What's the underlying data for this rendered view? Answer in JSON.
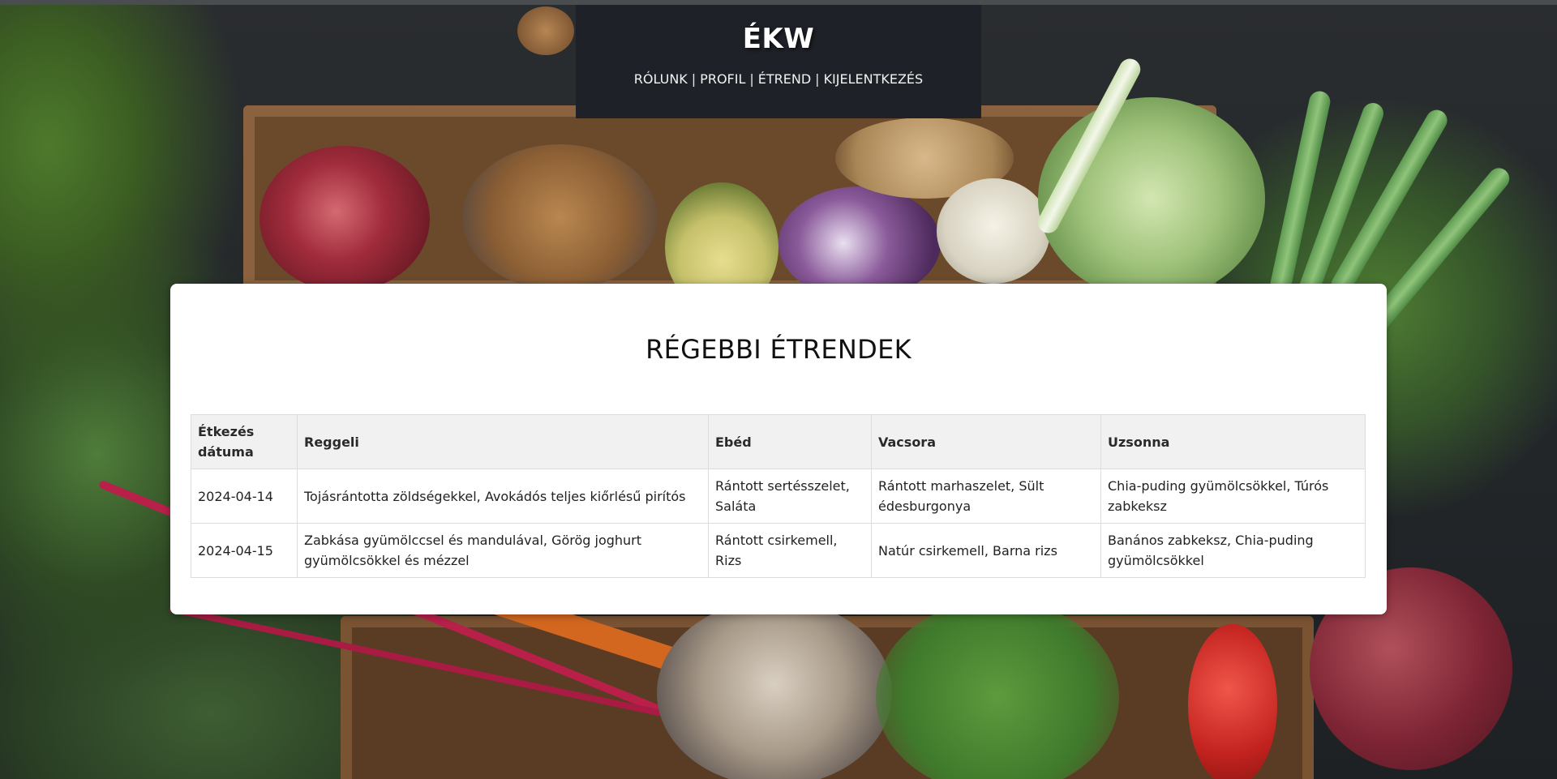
{
  "header": {
    "brand": "ÉKW",
    "nav": [
      {
        "label": "RÓLUNK"
      },
      {
        "label": "PROFIL"
      },
      {
        "label": "ÉTREND"
      },
      {
        "label": "KIJELENTKEZÉS"
      }
    ],
    "separator": "|"
  },
  "main": {
    "title": "RÉGEBBI ÉTRENDEK",
    "table": {
      "columns": [
        "Étkezés dátuma",
        "Reggeli",
        "Ebéd",
        "Vacsora",
        "Uzsonna"
      ],
      "rows": [
        {
          "date": "2024-04-14",
          "breakfast": "Tojásrántotta zöldségekkel, Avokádós teljes kiőrlésű pirítós",
          "lunch": "Rántott sertésszelet, Saláta",
          "dinner": "Rántott marhaszelet, Sült édesburgonya",
          "snack": "Chia-puding gyümölcsökkel, Túrós zabkeksz"
        },
        {
          "date": "2024-04-15",
          "breakfast": "Zabkása gyümölccsel és mandulával, Görög joghurt gyümölcsökkel és mézzel",
          "lunch": "Rántott csirkemell, Rizs",
          "dinner": "Natúr csirkemell, Barna rizs",
          "snack": "Banános zabkeksz, Chia-puding gyümölcsökkel"
        }
      ]
    }
  },
  "colors": {
    "header_bg": "#1e2128",
    "card_bg": "#ffffff",
    "table_header_bg": "#f1f1f1"
  }
}
